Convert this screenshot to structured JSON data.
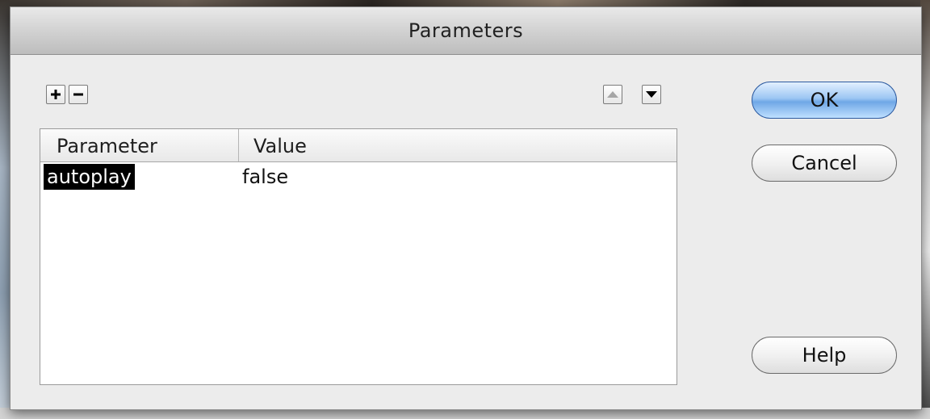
{
  "dialog": {
    "title": "Parameters"
  },
  "toolbar": {
    "add_icon": "plus-icon",
    "remove_icon": "minus-icon",
    "move_up_icon": "triangle-up-icon",
    "move_down_icon": "triangle-down-icon"
  },
  "table": {
    "columns": [
      "Parameter",
      "Value"
    ],
    "rows": [
      {
        "parameter": "autoplay",
        "value": "false",
        "selected": true
      }
    ]
  },
  "buttons": {
    "ok": "OK",
    "cancel": "Cancel",
    "help": "Help"
  },
  "colors": {
    "ok_accent": "#6fa7e6",
    "selection": "#000000",
    "selection_text": "#ffffff"
  }
}
